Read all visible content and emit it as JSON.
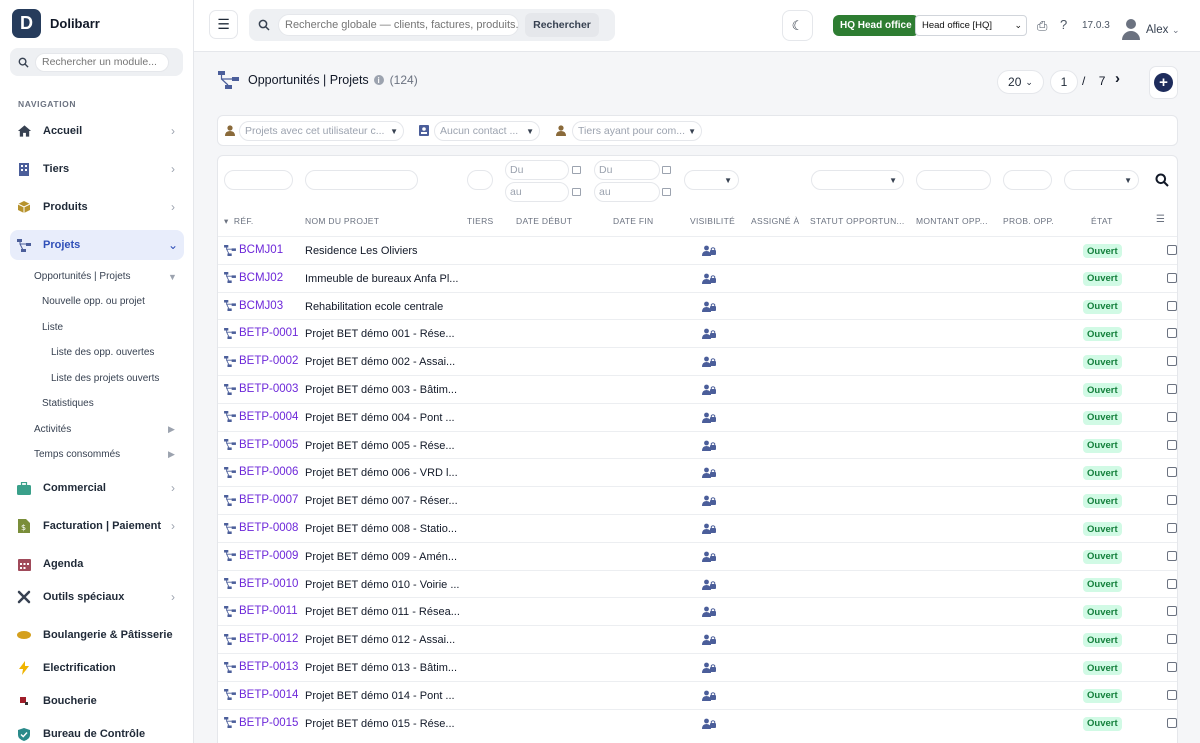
{
  "brand": {
    "logo_letter": "D",
    "name": "Dolibarr"
  },
  "sidebar": {
    "search_placeholder": "Rechercher un module...",
    "caption": "NAVIGATION",
    "items": [
      {
        "label": "Accueil",
        "icon": "home-icon"
      },
      {
        "label": "Tiers",
        "icon": "building-icon"
      },
      {
        "label": "Produits",
        "icon": "box-icon"
      },
      {
        "label": "Projets",
        "icon": "project-icon"
      },
      {
        "label": "Commercial",
        "icon": "briefcase-icon"
      },
      {
        "label": "Facturation | Paiement",
        "icon": "invoice-icon"
      },
      {
        "label": "Agenda",
        "icon": "calendar-icon"
      },
      {
        "label": "Outils spéciaux",
        "icon": "tools-icon"
      },
      {
        "label": "Boulangerie & Pâtisserie",
        "icon": "bread-icon"
      },
      {
        "label": "Electrification",
        "icon": "bolt-icon"
      },
      {
        "label": "Boucherie",
        "icon": "meat-icon"
      },
      {
        "label": "Bureau de Contrôle",
        "icon": "shield-icon"
      }
    ],
    "sub_items": [
      "Opportunités | Projets",
      "Nouvelle opp. ou projet",
      "Liste",
      "Liste des opp. ouvertes",
      "Liste des projets ouverts",
      "Statistiques",
      "Activités",
      "Temps consommés"
    ]
  },
  "header": {
    "search_placeholder": "Recherche globale — clients, factures, produits...",
    "search_button": "Rechercher",
    "entity_badge": "HQ Head office",
    "entity_select": "Head office [HQ]",
    "version": "17.0.3",
    "user": "Alex"
  },
  "page": {
    "title": "Opportunités | Projets",
    "count": "(124)",
    "limit": "20",
    "current_page": "1",
    "page_sep": "/",
    "total_pages": "7"
  },
  "filters": {
    "user_placeholder": "Projets avec cet utilisateur c...",
    "contact_placeholder": "Aucun contact ...",
    "tiers_placeholder": "Tiers ayant pour com...",
    "date_du": "Du",
    "date_au": "au"
  },
  "table": {
    "headers": [
      "RÉF.",
      "NOM DU PROJET",
      "TIERS",
      "DATE DÉBUT",
      "DATE FIN",
      "VISIBILITÉ",
      "ASSIGNÉ À",
      "STATUT OPPORTUN...",
      "MONTANT OPP...",
      "PROB. OPP.",
      "ÉTAT"
    ],
    "rows": [
      {
        "ref": "BCMJ01",
        "name": "Residence Les Oliviers",
        "state": "Ouvert"
      },
      {
        "ref": "BCMJ02",
        "name": "Immeuble de bureaux Anfa Pl...",
        "state": "Ouvert"
      },
      {
        "ref": "BCMJ03",
        "name": "Rehabilitation ecole centrale",
        "state": "Ouvert"
      },
      {
        "ref": "BETP-0001",
        "name": "Projet BET démo 001 - Rése...",
        "state": "Ouvert"
      },
      {
        "ref": "BETP-0002",
        "name": "Projet BET démo 002 - Assai...",
        "state": "Ouvert"
      },
      {
        "ref": "BETP-0003",
        "name": "Projet BET démo 003 - Bâtim...",
        "state": "Ouvert"
      },
      {
        "ref": "BETP-0004",
        "name": "Projet BET démo 004 - Pont ...",
        "state": "Ouvert"
      },
      {
        "ref": "BETP-0005",
        "name": "Projet BET démo 005 - Rése...",
        "state": "Ouvert"
      },
      {
        "ref": "BETP-0006",
        "name": "Projet BET démo 006 - VRD l...",
        "state": "Ouvert"
      },
      {
        "ref": "BETP-0007",
        "name": "Projet BET démo 007 - Réser...",
        "state": "Ouvert"
      },
      {
        "ref": "BETP-0008",
        "name": "Projet BET démo 008 - Statio...",
        "state": "Ouvert"
      },
      {
        "ref": "BETP-0009",
        "name": "Projet BET démo 009 - Amén...",
        "state": "Ouvert"
      },
      {
        "ref": "BETP-0010",
        "name": "Projet BET démo 010 - Voirie ...",
        "state": "Ouvert"
      },
      {
        "ref": "BETP-0011",
        "name": "Projet BET démo 011 - Résea...",
        "state": "Ouvert"
      },
      {
        "ref": "BETP-0012",
        "name": "Projet BET démo 012 - Assai...",
        "state": "Ouvert"
      },
      {
        "ref": "BETP-0013",
        "name": "Projet BET démo 013 - Bâtim...",
        "state": "Ouvert"
      },
      {
        "ref": "BETP-0014",
        "name": "Projet BET démo 014 - Pont ...",
        "state": "Ouvert"
      },
      {
        "ref": "BETP-0015",
        "name": "Projet BET démo 015 - Rése...",
        "state": "Ouvert"
      }
    ]
  },
  "colors": {
    "accent": "#2f4fb8",
    "ref_link": "#6d28d9",
    "status_open_bg": "#d1fae5",
    "status_open_fg": "#15803d",
    "entity_badge": "#2e7d32"
  }
}
